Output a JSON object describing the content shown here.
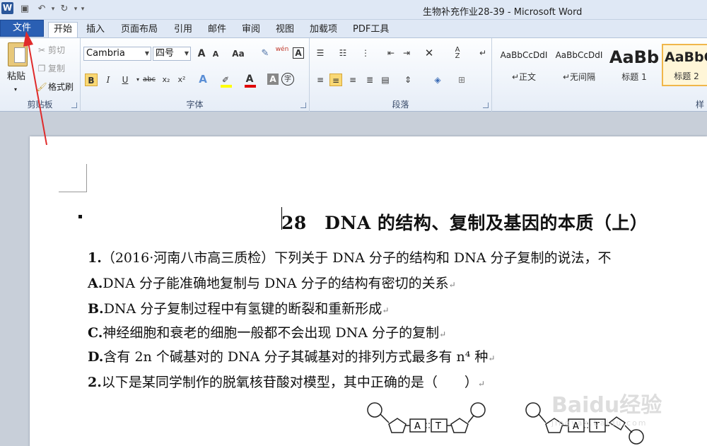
{
  "window": {
    "title": "生物补充作业28-39 - Microsoft Word",
    "app_icon": "W"
  },
  "quick_access": [
    {
      "name": "save-icon",
      "glyph": "💾"
    },
    {
      "name": "undo-icon",
      "glyph": "↶"
    },
    {
      "name": "redo-icon",
      "glyph": "↻"
    },
    {
      "name": "customize-icon",
      "glyph": "▾"
    }
  ],
  "tabs": {
    "file": "文件",
    "home": "开始",
    "insert": "插入",
    "layout": "页面布局",
    "references": "引用",
    "mailings": "邮件",
    "review": "审阅",
    "view": "视图",
    "addins": "加载项",
    "pdf": "PDF工具"
  },
  "clipboard": {
    "paste": "粘贴",
    "cut": "剪切",
    "copy": "复制",
    "format_painter": "格式刷",
    "label": "剪贴板"
  },
  "font": {
    "name": "Cambria",
    "size": "四号",
    "grow": "A",
    "shrink": "A",
    "case": "Aa",
    "phonetic": "wén",
    "bold": "B",
    "italic": "I",
    "underline": "U",
    "strike": "abc",
    "sub": "x₂",
    "sup": "x²",
    "color_letter": "A",
    "char_shade": "A",
    "enclose": "字",
    "label": "字体"
  },
  "paragraph": {
    "label": "段落"
  },
  "styles": {
    "items": [
      {
        "sample": "AaBbCcDdI",
        "name": "↵正文"
      },
      {
        "sample": "AaBbCcDdI",
        "name": "↵无间隔"
      },
      {
        "sample": "AaBb",
        "name": "标题 1"
      },
      {
        "sample": "AaBbC",
        "name": "标题 2"
      }
    ],
    "label": "样"
  },
  "document": {
    "heading": "28　DNA 的结构、复制及基因的本质（上）",
    "lines": [
      {
        "num": "1.",
        "text": "（2016·河南八市高三质检）下列关于 DNA 分子的结构和 DNA 分子复制的说法，不"
      },
      {
        "num": "A.",
        "text": "DNA 分子能准确地复制与 DNA 分子的结构有密切的关系"
      },
      {
        "num": "B.",
        "text": "DNA 分子复制过程中有氢键的断裂和重新形成"
      },
      {
        "num": "C.",
        "text": "神经细胞和衰老的细胞一般都不会出现 DNA 分子的复制"
      },
      {
        "num": "D.",
        "text": "含有 2n 个碱基对的 DNA 分子其碱基对的排列方式最多有 n⁴ 种"
      },
      {
        "num": "2.",
        "text": "以下是某同学制作的脱氧核苷酸对模型，其中正确的是（　　）"
      }
    ],
    "para_mark": "↵"
  },
  "models": {
    "left": [
      "A",
      "T"
    ],
    "right": [
      "A",
      "T"
    ]
  },
  "watermark": {
    "text": "Baidu经验",
    "sub": "jingyan.baidu.com"
  }
}
